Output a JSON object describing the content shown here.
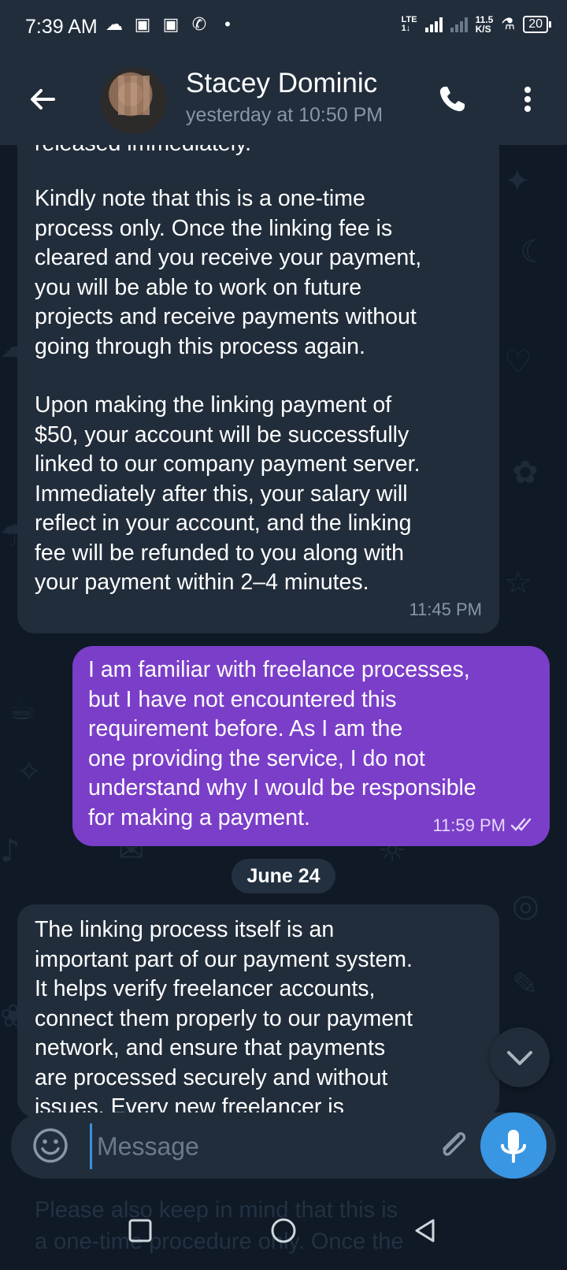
{
  "status_bar": {
    "time": "7:39 AM",
    "net_type": "LTE",
    "net_sub": "1↓",
    "speed": "11.5",
    "speed_unit": "K/S",
    "battery": "20",
    "app_icons": [
      "snapchat-icon",
      "instagram-icon",
      "instagram-icon",
      "whatsapp-icon",
      "dot-icon"
    ]
  },
  "header": {
    "name": "Stacey Dominic",
    "last_seen": "yesterday at 10:50 PM"
  },
  "messages": [
    {
      "direction": "incoming",
      "text_clip": "released immediately.",
      "paragraphs": [
        "Kindly note that this is a one-time\nprocess only. Once the linking fee is\ncleared and you receive your payment,\nyou will be able to work on future\nprojects and receive payments without\ngoing through this process again.",
        "Upon making the linking payment of\n$50, your account will be successfully\nlinked to our company payment server.\nImmediately after this, your salary will\nreflect in your account, and the linking\nfee will be refunded to you along with\nyour payment within 2–4 minutes."
      ],
      "time": "11:45 PM"
    },
    {
      "direction": "outgoing",
      "text": "I am familiar with freelance processes,\nbut I have not encountered this\nrequirement before. As I am the\none providing the service, I do not\nunderstand why I would be responsible\nfor making a payment.",
      "time": "11:59 PM",
      "status": "read"
    },
    {
      "direction": "incoming",
      "text": "The linking process itself is an\nimportant part of our payment system.\nIt helps verify freelancer accounts,\nconnect them properly to our payment\nnetwork, and ensure that payments\nare processed securely and without\nissues. Every new freelancer is"
    }
  ],
  "date_separator": "June 24",
  "input": {
    "placeholder": "Message"
  },
  "behind_keyboard_text": {
    "line1": "Please also keep in mind that this is",
    "line2": "a one-time procedure only. Once the"
  },
  "colors": {
    "background": "#0f1a26",
    "bar": "#212d3b",
    "incoming_bubble": "#212d3b",
    "outgoing_bubble": "#7b3ec9",
    "accent": "#3996e3",
    "muted_text": "#8797a6"
  }
}
